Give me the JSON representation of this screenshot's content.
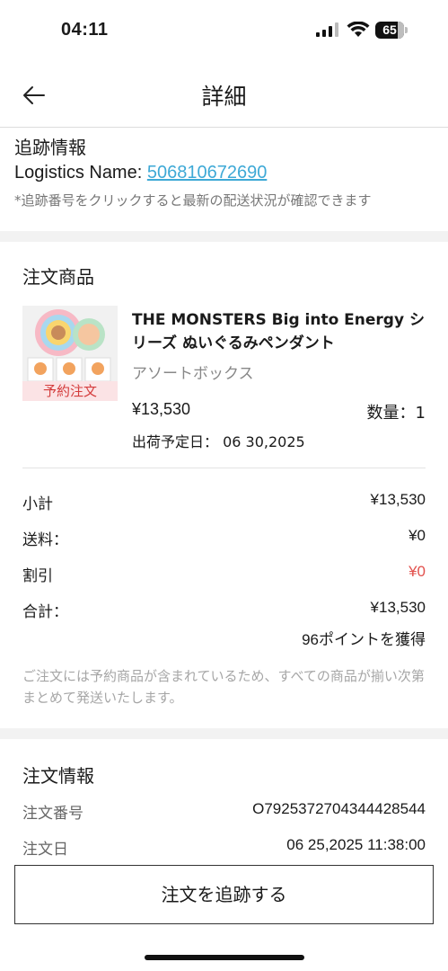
{
  "status_bar": {
    "time": "04:11",
    "battery": "65"
  },
  "nav": {
    "title": "詳細"
  },
  "tracking": {
    "title": "追跡情報",
    "logistics_label": "Logistics Name: ",
    "logistics_number": "506810672690",
    "note": "*追跡番号をクリックすると最新の配送状況が確認できます"
  },
  "order_items": {
    "title": "注文商品",
    "product": {
      "name": "THE MONSTERS Big into Energy シリーズ ぬいぐるみペンダント",
      "variant": "アソートボックス",
      "price": "¥13,530",
      "quantity": "数量：1",
      "ship_date": "出荷予定日： 06 30,2025",
      "tag": "予約注文"
    }
  },
  "summary": {
    "subtotal_label": "小計",
    "subtotal_value": "¥13,530",
    "shipping_label": "送料：",
    "shipping_value": "¥0",
    "discount_label": "割引",
    "discount_value": "¥0",
    "total_label": "合計：",
    "total_value": "¥13,530",
    "points": "96ポイントを獲得",
    "notice": "ご注文には予約商品が含まれているため、すべての商品が揃い次第まとめて発送いたします。"
  },
  "order_info": {
    "title": "注文情報",
    "number_label": "注文番号",
    "number_value": "O792537270434442854​4",
    "date_label": "注文日",
    "date_value": "06 25,2025 11:38:00"
  },
  "actions": {
    "track_button": "注文を追跡する"
  },
  "colors": {
    "link": "#3ea9d6",
    "discount": "#e2504c",
    "preorder_tag_bg": "#fbe3e5",
    "preorder_tag_text": "#d43c3c"
  }
}
